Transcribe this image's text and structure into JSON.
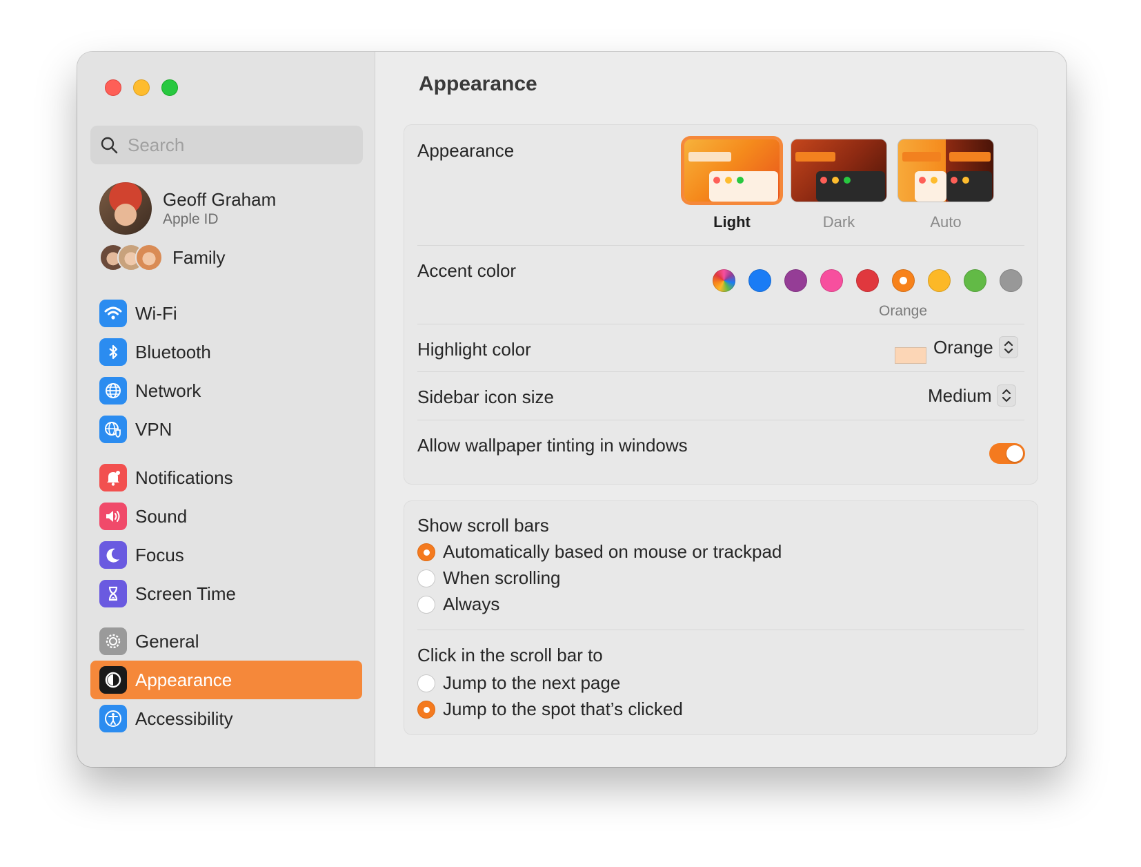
{
  "search": {
    "placeholder": "Search"
  },
  "account": {
    "name": "Geoff Graham",
    "subtitle": "Apple ID"
  },
  "family": {
    "label": "Family"
  },
  "sidebar": {
    "groups": [
      [
        {
          "label": "Wi-Fi",
          "icon": "wifi-icon",
          "color": "#2b8cf0"
        },
        {
          "label": "Bluetooth",
          "icon": "bluetooth-icon",
          "color": "#2b8cf0"
        },
        {
          "label": "Network",
          "icon": "globe-icon",
          "color": "#2b8cf0"
        },
        {
          "label": "VPN",
          "icon": "vpn-icon",
          "color": "#2b8cf0"
        }
      ],
      [
        {
          "label": "Notifications",
          "icon": "bell-icon",
          "color": "#f2504f"
        },
        {
          "label": "Sound",
          "icon": "speaker-icon",
          "color": "#f04a6a"
        },
        {
          "label": "Focus",
          "icon": "moon-icon",
          "color": "#6a5ae0"
        },
        {
          "label": "Screen Time",
          "icon": "hourglass-icon",
          "color": "#6a5ae0"
        }
      ],
      [
        {
          "label": "General",
          "icon": "gear-icon",
          "color": "#9a9a9a"
        },
        {
          "label": "Appearance",
          "icon": "appearance-icon",
          "color": "#1a1a1a",
          "active": true
        },
        {
          "label": "Accessibility",
          "icon": "accessibility-icon",
          "color": "#2b8cf0"
        }
      ]
    ]
  },
  "main": {
    "title": "Appearance",
    "appearance": {
      "label": "Appearance",
      "options": [
        {
          "label": "Light",
          "selected": true
        },
        {
          "label": "Dark",
          "selected": false
        },
        {
          "label": "Auto",
          "selected": false
        }
      ]
    },
    "accent": {
      "label": "Accent color",
      "selected_name": "Orange",
      "colors": [
        "multicolor",
        "#1a7cf5",
        "#953d96",
        "#f74f9e",
        "#e0383e",
        "#f7821b",
        "#fcb827",
        "#62ba46",
        "#989898"
      ],
      "selected_index": 5
    },
    "highlight": {
      "label": "Highlight color",
      "value": "Orange",
      "swatch": "#fcd6b6"
    },
    "sidebar_icon_size": {
      "label": "Sidebar icon size",
      "value": "Medium"
    },
    "wallpaper_tinting": {
      "label": "Allow wallpaper tinting in windows",
      "enabled": true
    },
    "scroll_bars": {
      "label": "Show scroll bars",
      "options": [
        "Automatically based on mouse or trackpad",
        "When scrolling",
        "Always"
      ],
      "selected_index": 0
    },
    "click_scroll": {
      "label": "Click in the scroll bar to",
      "options": [
        "Jump to the next page",
        "Jump to the spot that’s clicked"
      ],
      "selected_index": 1
    }
  },
  "colors": {
    "accent": "#f5883a",
    "toggle_on": "#f47a1f"
  }
}
